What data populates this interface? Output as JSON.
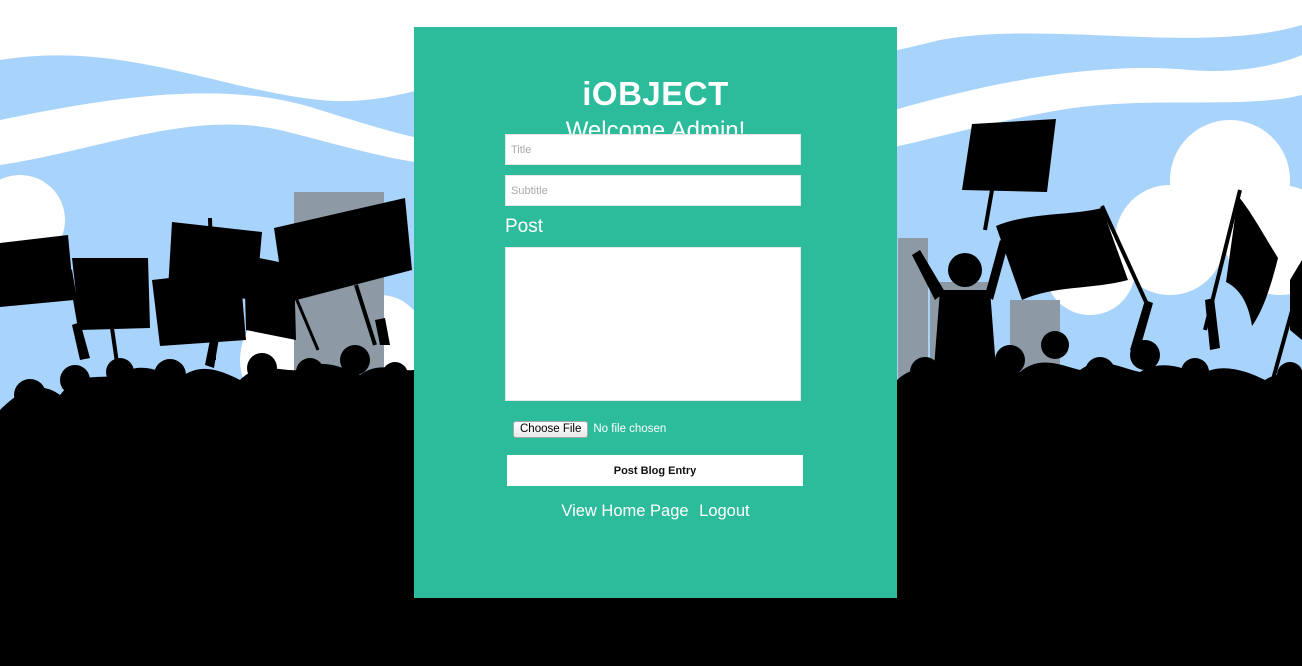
{
  "app": {
    "brand": "iOBJECT",
    "welcome": "Welcome Admin!"
  },
  "form": {
    "title_placeholder": "Title",
    "title_value": "",
    "subtitle_placeholder": "Subtitle",
    "subtitle_value": "",
    "post_label": "Post",
    "post_value": "",
    "file_button_label": "Choose File",
    "file_status": "No file chosen",
    "submit_label": "Post Blog Entry"
  },
  "nav": {
    "home_link": "View Home Page",
    "logout_link": "Logout"
  },
  "colors": {
    "panel": "#2dbc9b",
    "sky": "#a8d3fa",
    "cloud": "#ffffff",
    "buildings": "#8d9aa6",
    "crowd": "#000000"
  },
  "icons": {
    "background": "protest-crowd-illustration"
  }
}
